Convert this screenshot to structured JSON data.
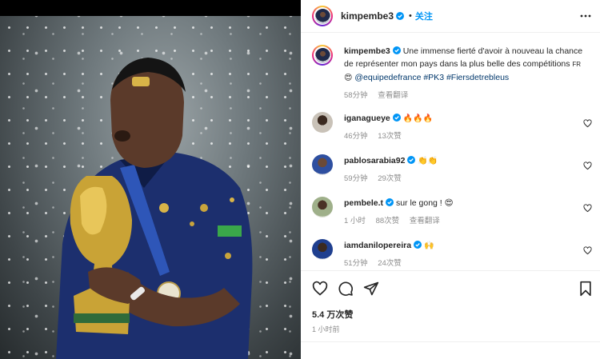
{
  "post": {
    "author": "kimpembe3",
    "follow_label": "关注",
    "separator": "•",
    "caption": {
      "text": "Une immense fierté d'avoir à nouveau la chance de représenter mon pays dans la plus belle des compétitions",
      "flag": "FR",
      "emoji": "😍",
      "mention": "@equipedefrance",
      "hashtags": "#PK3 #Fiersdetrebleus",
      "time": "58分钟",
      "translate": "查看翻译"
    }
  },
  "comments": [
    {
      "username": "iganagueye",
      "text": "🔥🔥🔥",
      "time": "46分钟",
      "likes": "13次赞",
      "translate": ""
    },
    {
      "username": "pablosarabia92",
      "text": "👏👏",
      "time": "59分钟",
      "likes": "29次赞",
      "translate": ""
    },
    {
      "username": "pembele.t",
      "text": "sur le gong ! 😍",
      "time": "1 小时",
      "likes": "88次赞",
      "translate": "查看翻译"
    },
    {
      "username": "iamdanilopereira",
      "text": "🙌",
      "time": "51分钟",
      "likes": "24次赞",
      "translate": ""
    }
  ],
  "footer": {
    "likes": "5.4 万次赞",
    "posted": "1 小时前"
  },
  "icons": [
    "verified-icon",
    "more-icon",
    "heart-icon",
    "comment-icon",
    "share-icon",
    "save-icon"
  ],
  "colors": {
    "link": "#00376b",
    "follow": "#0095f6",
    "muted": "#8e8e8e"
  }
}
